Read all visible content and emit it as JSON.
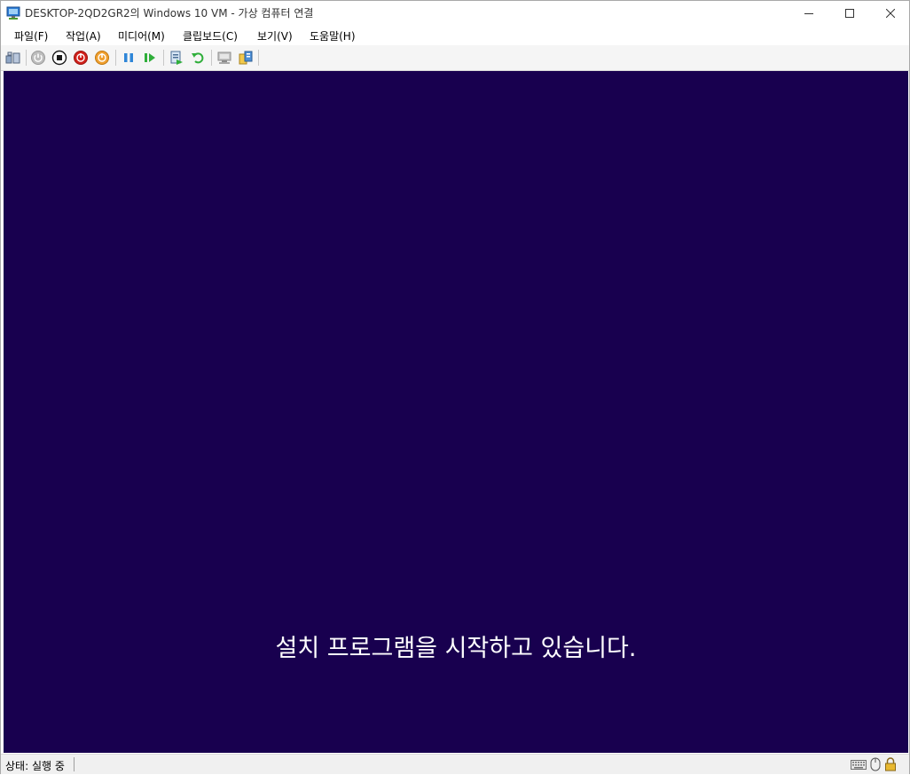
{
  "window": {
    "title": "DESKTOP-2QD2GR2의 Windows 10 VM - 가상 컴퓨터 연결"
  },
  "menu": {
    "items": [
      {
        "label": "파일(F)"
      },
      {
        "label": "작업(A)"
      },
      {
        "label": "미디어(M)"
      },
      {
        "label": "클립보드(C)"
      },
      {
        "label": "보기(V)"
      },
      {
        "label": "도움말(H)"
      }
    ]
  },
  "toolbar": {
    "buttons": [
      {
        "icon": "ctrl-alt-del-icon"
      },
      {
        "icon": "start-icon"
      },
      {
        "icon": "turn-off-icon"
      },
      {
        "icon": "shut-down-icon"
      },
      {
        "icon": "save-icon"
      },
      {
        "icon": "pause-icon"
      },
      {
        "icon": "resume-icon"
      },
      {
        "icon": "checkpoint-icon"
      },
      {
        "icon": "revert-icon"
      },
      {
        "icon": "enhanced-session-icon"
      },
      {
        "icon": "share-icon"
      }
    ]
  },
  "vm": {
    "background_color": "#18004f",
    "message": "설치 프로그램을 시작하고 있습니다."
  },
  "status": {
    "text": "상태: 실행 중",
    "icons": [
      "keyboard-icon",
      "mouse-icon",
      "lock-icon"
    ]
  }
}
